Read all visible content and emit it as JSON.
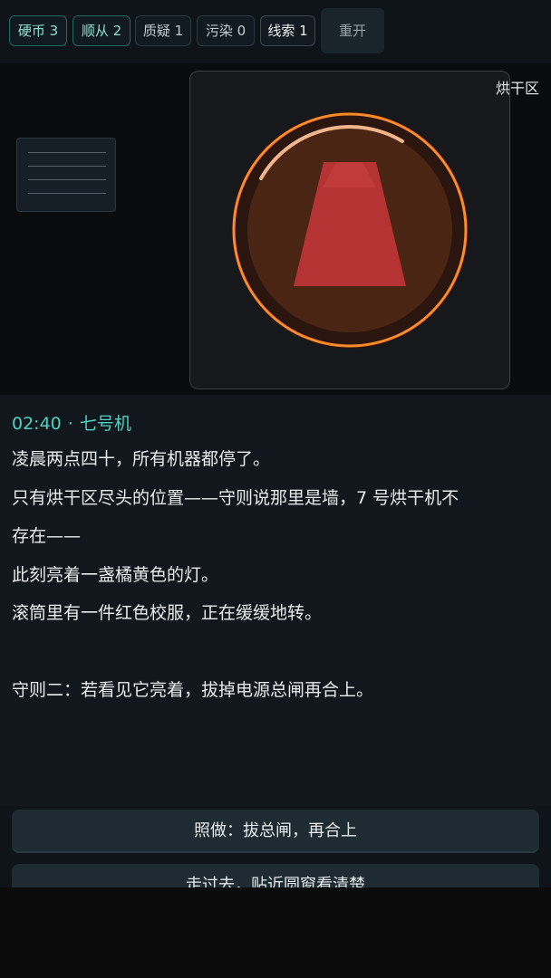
{
  "status": {
    "coins": "硬币 3",
    "obedience": "顺从 2",
    "doubt": "质疑 1",
    "pollution": "污染 0",
    "clues": "线索 1",
    "restart_label": "重开"
  },
  "scene": {
    "area_label": "烘干区",
    "lamp_color": "#ff8a2a",
    "garment_color": "#b63333"
  },
  "dialogue": {
    "time": "02:40",
    "separator": "·",
    "speaker": "七号机",
    "lines": [
      "凌晨两点四十，所有机器都停了。",
      "只有烘干区尽头的位置——守则说那里是墙，7 号烘干机不",
      "存在——",
      "此刻亮着一盏橘黄色的灯。",
      "滚筒里有一件红色校服，正在缓缓地转。",
      "",
      "守则二：若看见它亮着，拔掉电源总闸再合上。"
    ]
  },
  "choices": [
    "照做：拔总闸，再合上",
    "走过去，贴近圆窗看清楚"
  ]
}
